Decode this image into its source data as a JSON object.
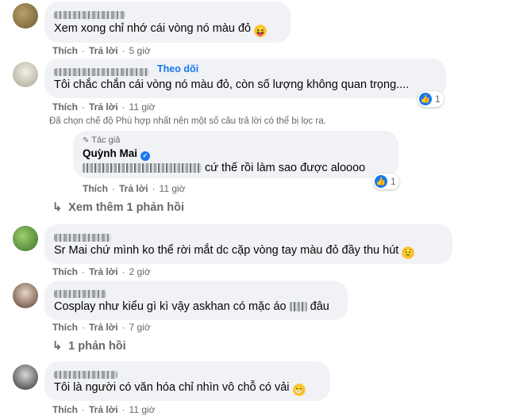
{
  "actions": {
    "like": "Thích",
    "reply": "Trả lời",
    "sep": "·"
  },
  "comments": [
    {
      "text": "Xem xong chỉ nhớ cái vòng nó màu đỏ",
      "time": "5 giờ"
    },
    {
      "follow": "Theo dõi",
      "text": "Tôi chắc chắn cái vòng nó màu đỏ, còn số lượng không quan trọng....",
      "time": "11 giờ",
      "reactions": "1"
    },
    {
      "text": "Sr Mai chứ mình ko thể rời mắt dc cặp vòng tay màu đỏ đầy thu hút",
      "time": "2 giờ",
      "replies": "Xem thêm 1 phản hồi"
    },
    {
      "text_before": "Cosplay như kiểu gì kì vậy askhan có mặc áo",
      "text_after": "đâu",
      "time": "7 giờ",
      "replies": "1 phản hồi"
    },
    {
      "text": "Tôi là người có văn hóa chỉ nhìn vô chỗ có vải",
      "time": "11 giờ"
    }
  ],
  "filter_notice": "Đã chọn chế độ Phù hợp nhất nên một số câu trả lời có thể bị lọc ra.",
  "reply": {
    "badge": "Tác giả",
    "author": "Quỳnh Mai",
    "text": "cứ thế rồi làm sao được aloooo",
    "time": "11 giờ",
    "reactions": "1"
  },
  "colors": {
    "bubble": "#f0f2f5",
    "link": "#1877f2",
    "meta": "#65676b",
    "text": "#050505"
  },
  "icons": [
    "grinning-squint-tongue-emoji",
    "thumbs-up-reaction-icon",
    "verified-badge-icon",
    "author-badge-icon",
    "reply-arrow-icon",
    "worried-face-emoji",
    "grinning-face-emoji"
  ]
}
